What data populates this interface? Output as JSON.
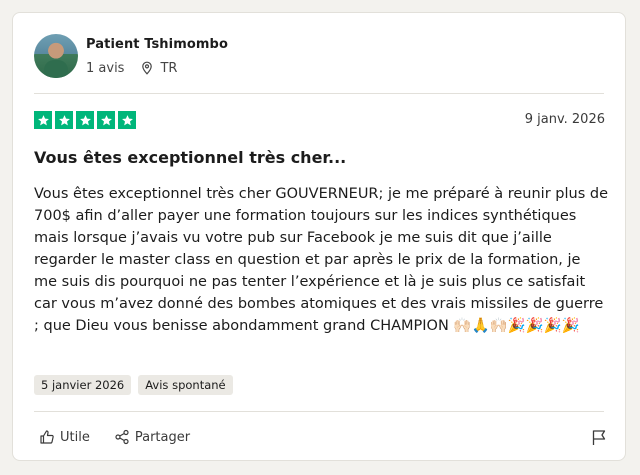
{
  "review": {
    "user": {
      "name": "Patient Tshimombo",
      "reviews_count": "1 avis",
      "country": "TR"
    },
    "rating": {
      "stars": 5,
      "max": 5,
      "color": "#00b67a"
    },
    "date": "9 janv. 2026",
    "title": "Vous êtes exceptionnel très cher...",
    "body": "Vous êtes exceptionnel très cher GOUVERNEUR; je me préparé à reunir plus de 700$ afin d’aller payer une formation toujours sur les indices synthétiques mais lorsque j’avais vu votre pub sur Facebook je me suis dit que j’aille regarder le master class en question et par après le prix de la formation,  je me suis dis pourquoi ne pas tenter l’expérience et là je suis plus ce satisfait car vous m’avez donné des bombes atomiques et des vrais missiles de guerre ; que Dieu vous benisse abondamment grand CHAMPION 🙌🏻🙏🙌🏻🎉🎉🎉🎉",
    "tags": [
      "5 janvier 2026",
      "Avis spontané"
    ],
    "actions": {
      "useful_label": "Utile",
      "share_label": "Partager"
    },
    "icons": {
      "useful": "thumbs-up-icon",
      "share": "share-icon",
      "location": "map-pin-icon",
      "report": "flag-icon"
    }
  }
}
